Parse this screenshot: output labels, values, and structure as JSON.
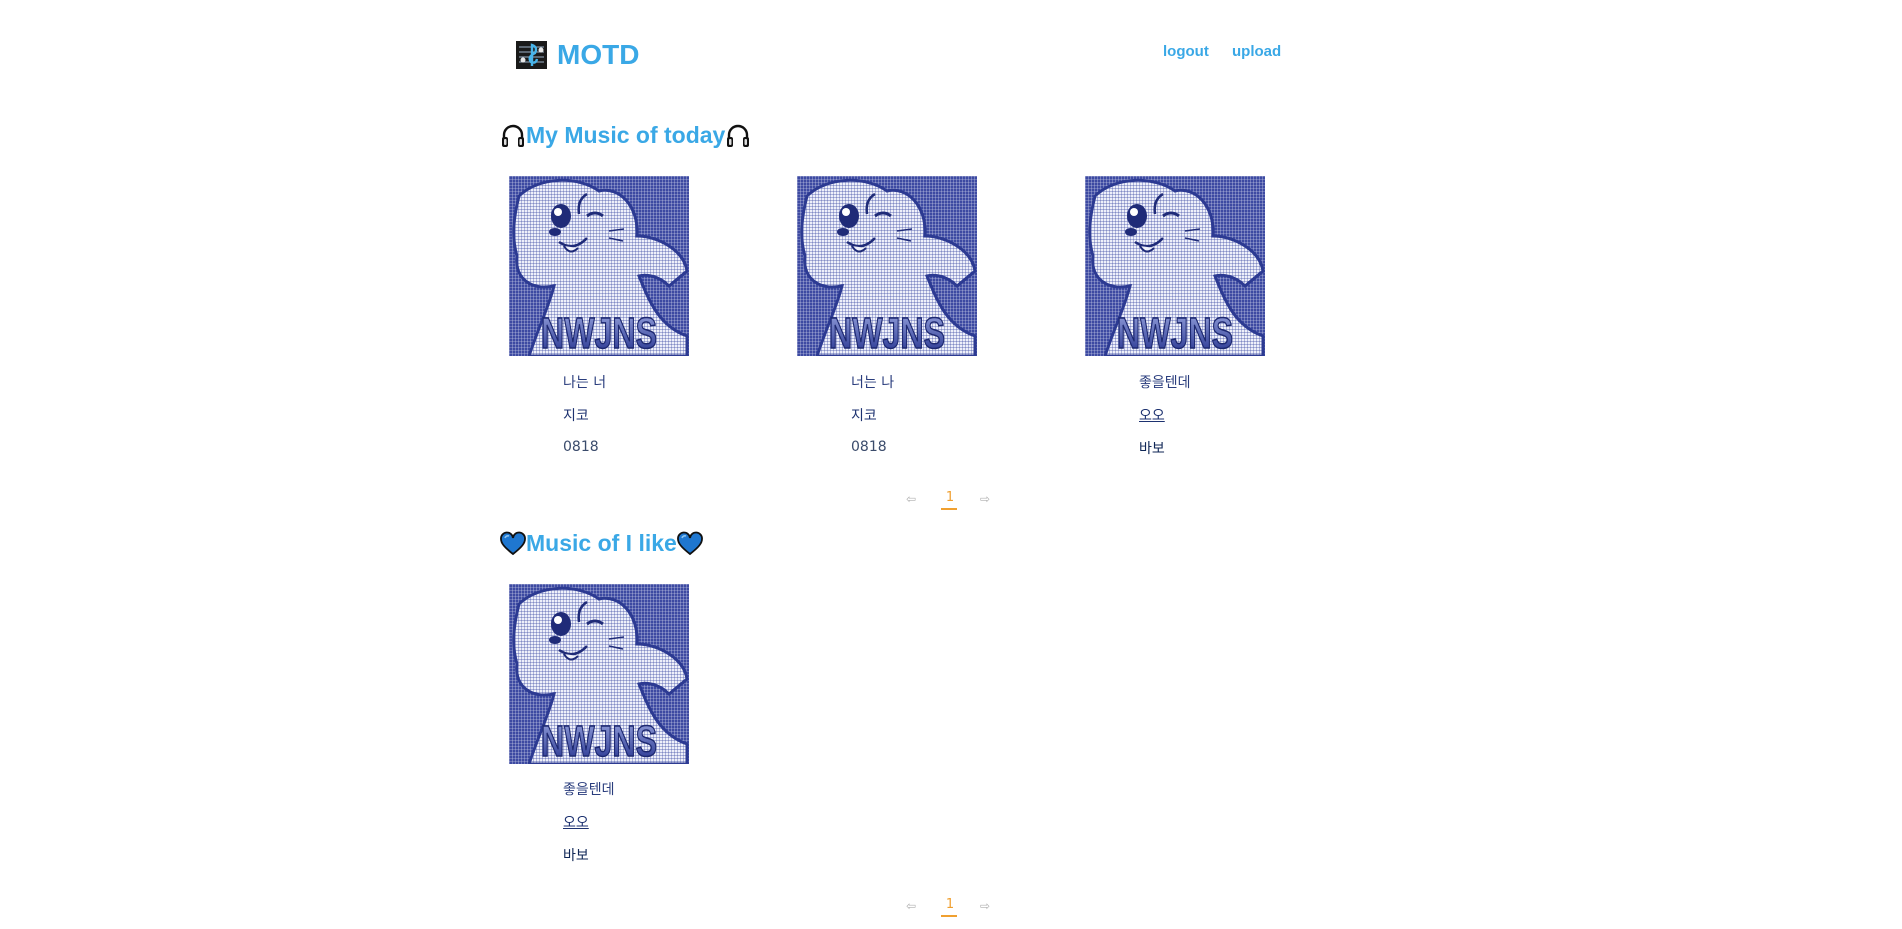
{
  "header": {
    "logo_text": "MOTD",
    "logo_icon": "music-notes-icon",
    "nav": {
      "logout": "logout",
      "upload": "upload"
    }
  },
  "today": {
    "title": "My Music of today",
    "title_icon": "headphones-icon",
    "cards": [
      {
        "title": "나는 너",
        "artist": "지코",
        "user": "0818"
      },
      {
        "title": "너는 나",
        "artist": "지코",
        "user": "0818"
      },
      {
        "title": "좋을텐데",
        "artist": "오오",
        "user": "바보"
      }
    ],
    "pager": {
      "prev": "⇦",
      "page": "1",
      "next": "⇨"
    }
  },
  "liked": {
    "title": "Music of I like",
    "title_icon": "heart-icon",
    "cards": [
      {
        "title": "좋을텐데",
        "artist": "오오",
        "user": "바보"
      }
    ],
    "pager": {
      "prev": "⇦",
      "page": "1",
      "next": "⇨"
    }
  },
  "cover_art": {
    "text": "NWJNS",
    "color": "#2f3e9a"
  },
  "colors": {
    "accent": "#3aa8e6",
    "page_accent": "#f0a030"
  }
}
